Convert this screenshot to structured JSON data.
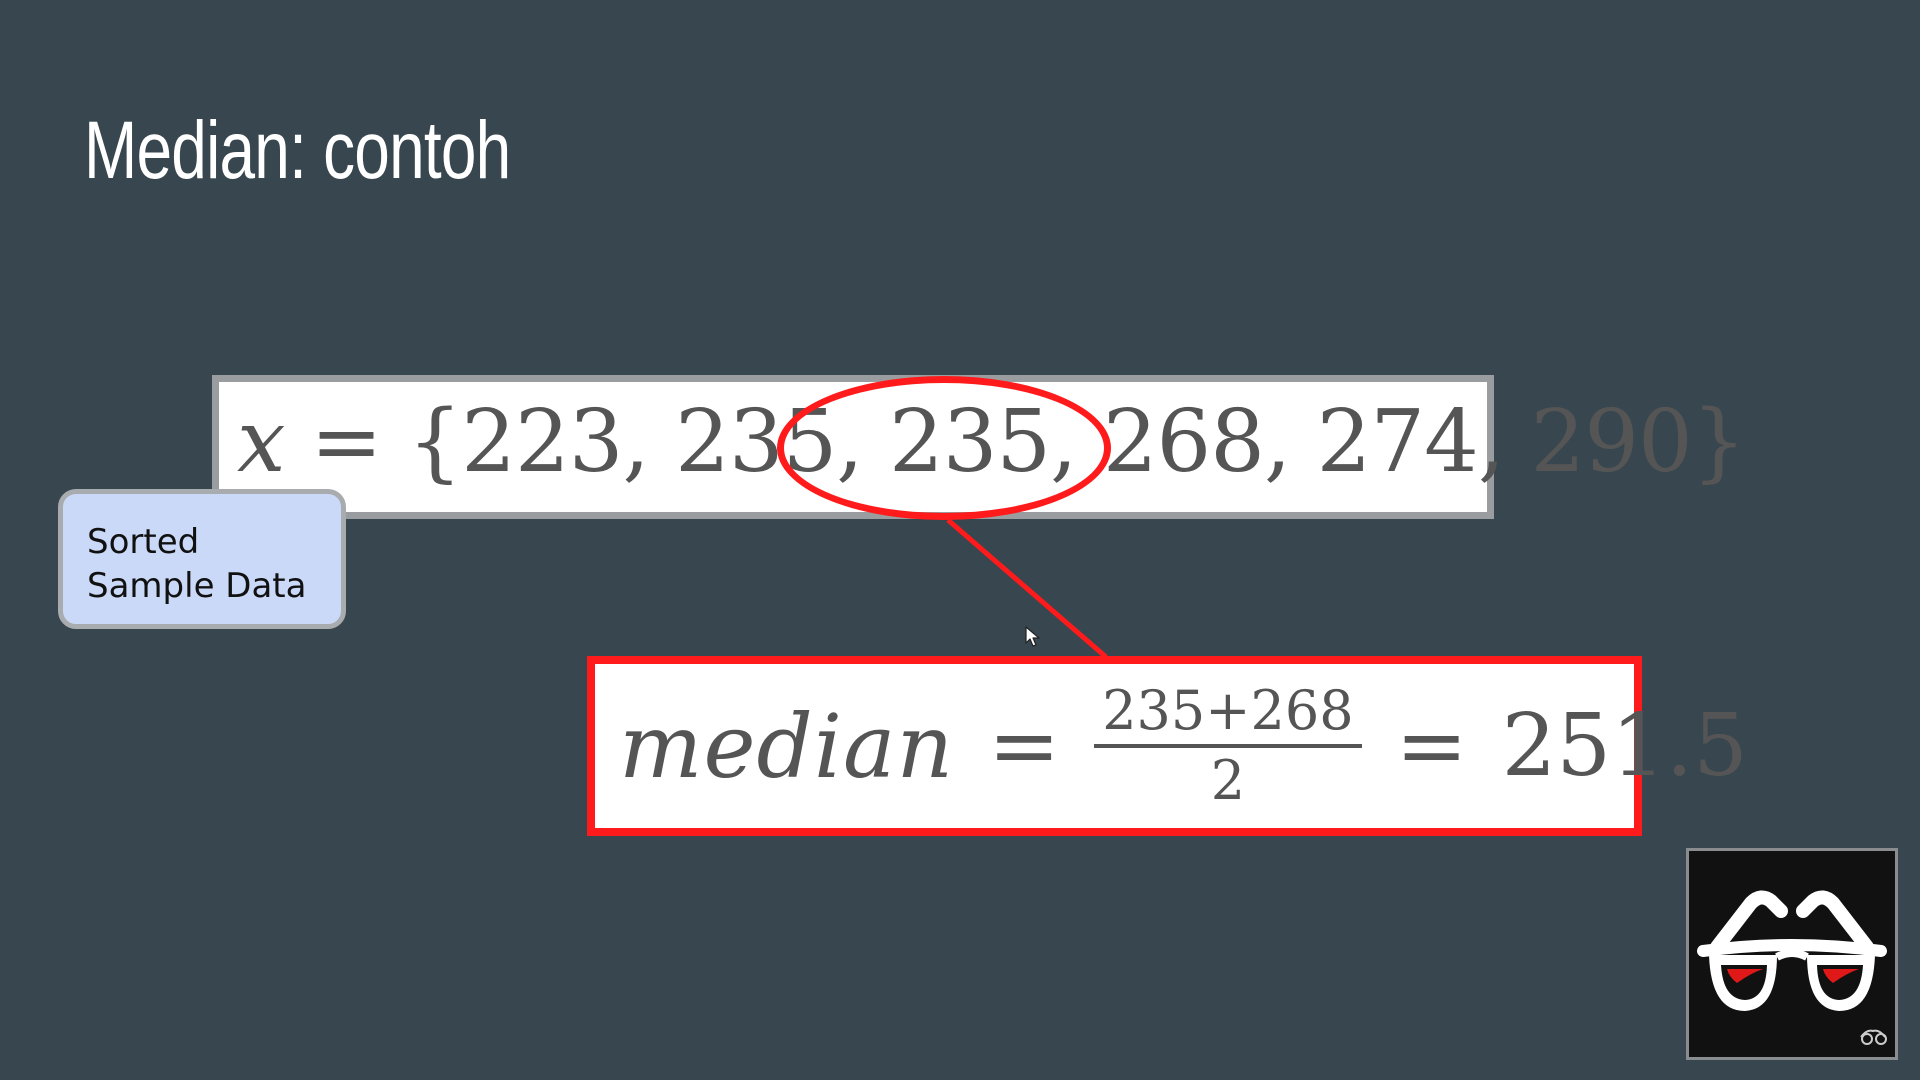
{
  "slide": {
    "title": "Median: contoh"
  },
  "set_equation": {
    "variable": "x",
    "equals": "=",
    "open_brace": "{",
    "close_brace": "}",
    "values": [
      "223",
      "235",
      "235",
      "268",
      "274",
      "290"
    ],
    "separator": ","
  },
  "callout": {
    "line1": "Sorted",
    "line2": "Sample Data"
  },
  "median_formula": {
    "word": "median",
    "equals": "=",
    "numerator": "235+268",
    "denominator": "2",
    "result": "251.5"
  },
  "colors": {
    "background": "#37464f",
    "highlight": "#ff1b1b",
    "callout_fill": "#cad9f7",
    "box_border": "#9a9d9f"
  },
  "icons": {
    "logo": "glasses-logo-icon",
    "cursor": "mouse-pointer-icon"
  }
}
